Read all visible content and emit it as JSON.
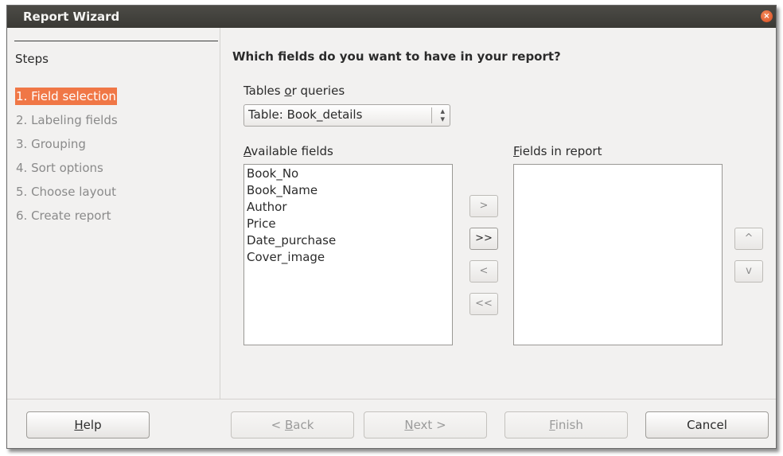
{
  "window": {
    "title": "Report Wizard",
    "close_glyph": "×"
  },
  "steps": {
    "title": "Steps",
    "items": [
      {
        "label": "1. Field selection",
        "active": true
      },
      {
        "label": "2. Labeling fields",
        "active": false
      },
      {
        "label": "3. Grouping",
        "active": false
      },
      {
        "label": "4. Sort options",
        "active": false
      },
      {
        "label": "5. Choose layout",
        "active": false
      },
      {
        "label": "6. Create report",
        "active": false
      }
    ]
  },
  "main": {
    "heading": "Which fields do you want to have in your report?",
    "tables_label_pre": "Tables ",
    "tables_label_u": "o",
    "tables_label_post": "r queries",
    "table_select": "Table: Book_details",
    "available_label_u": "A",
    "available_label_post": "vailable fields",
    "available_fields": [
      "Book_No",
      "Book_Name",
      "Author",
      "Price",
      "Date_purchase",
      "Cover_image"
    ],
    "report_label_u": "F",
    "report_label_post": "ields in report",
    "move_buttons": {
      "add": ">",
      "add_all": ">>",
      "remove": "<",
      "remove_all": "<<"
    },
    "order_buttons": {
      "up": "^",
      "down": "v"
    }
  },
  "footer": {
    "help_u": "H",
    "help_post": "elp",
    "back_pre": "< ",
    "back_u": "B",
    "back_post": "ack",
    "next_u": "N",
    "next_post": "ext >",
    "finish_u": "F",
    "finish_post": "inish",
    "cancel": "Cancel"
  },
  "colors": {
    "accent": "#f07746",
    "titlebar": "#3c3b37"
  }
}
